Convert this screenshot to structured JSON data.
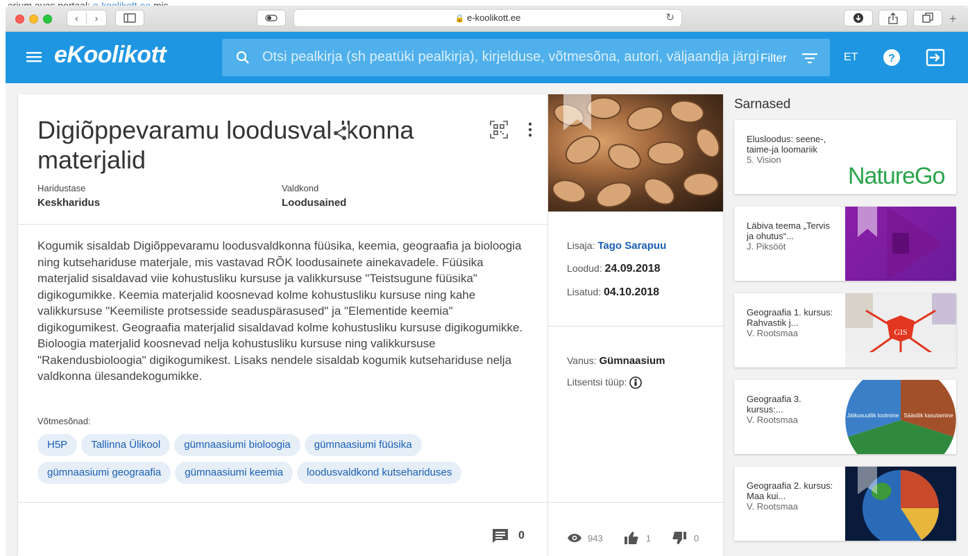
{
  "browser": {
    "url": "e-koolikott.ee"
  },
  "background_page": {
    "top_text": "sterium avas portaal:",
    "top_link": "e-koolikott.ee",
    "top_rest": " mis"
  },
  "appbar": {
    "logo": "eKoolikott",
    "search_placeholder": "Otsi pealkirja (sh peatüki pealkirja), kirjelduse, võtmesõna, autori, väljaandja järgi",
    "filter_label": "Filter",
    "language": "ET"
  },
  "material": {
    "title": "Digiõppevaramu loodusvaldkonna materjalid",
    "level_label": "Haridustase",
    "level_value": "Keskharidus",
    "domain_label": "Valdkond",
    "domain_value": "Loodusained",
    "description": "Kogumik sisaldab Digiõppevaramu loodusvaldkonna füüsika, keemia, geograafia ja bioloogia ning kutsehariduse materjale, mis vastavad RÕK loodusainete ainekavadele. Füüsika materjalid sisaldavad viie kohustusliku kursuse ja valikkursuse \"Teistsugune füüsika\" digikogumikke. Keemia materjalid koosnevad kolme kohustusliku kursuse ning kahe valikkursuse \"Keemiliste protsesside seaduspärasused\" ja \"Elementide keemia\" digikogumikest. Geograafia materjalid sisaldavad kolme kohustusliku kursuse digikogumikke. Bioloogia materjalid koosnevad nelja kohustusliku kursuse ning valikkursuse \"Rakendusbioloogia\" digikogumikest. Lisaks nendele sisaldab kogumik kutsehariduse nelja valdkonna ülesandekogumikke.",
    "keywords_label": "Võtmesõnad:",
    "keywords": [
      "H5P",
      "Tallinna Ülikool",
      "gümnaasiumi bioloogia",
      "gümnaasiumi füüsika",
      "gümnaasiumi geograafia",
      "gümnaasiumi keemia",
      "loodusvaldkond kutsehariduses"
    ],
    "comments_count": "0"
  },
  "info": {
    "added_by_label": "Lisaja:",
    "added_by": "Tago Sarapuu",
    "created_label": "Loodud:",
    "created": "24.09.2018",
    "added_label": "Lisatud:",
    "added": "04.10.2018",
    "age_label": "Vanus:",
    "age": "Gümnaasium",
    "license_label": "Litsentsi tüüp:",
    "views": "943",
    "likes": "1",
    "dislikes": "0"
  },
  "similar": {
    "heading": "Sarnased",
    "items": [
      {
        "title": "Elusloodus: seene-, taime-ja loomariik",
        "author": "5. Vision",
        "thumb_text": "NatureGo"
      },
      {
        "title": "Läbiva teema „Tervis ja ohutus“...",
        "author": "J. Piksööt"
      },
      {
        "title": "Geograafia 1. kursus: Rahvastik j...",
        "author": "V. Rootsmaa",
        "thumb_text": "GIS"
      },
      {
        "title": "Geograafia 3. kursus:...",
        "author": "V. Rootsmaa",
        "thumb_left": "Jätkusuutlik tootmine",
        "thumb_right": "Säästlik kasutamine"
      },
      {
        "title": "Geograafia 2. kursus: Maa kui...",
        "author": "V. Rootsmaa"
      }
    ]
  },
  "colors": {
    "appbar": "#1e96e2",
    "link": "#1a5fb4",
    "chip_bg": "#e6eef8"
  }
}
